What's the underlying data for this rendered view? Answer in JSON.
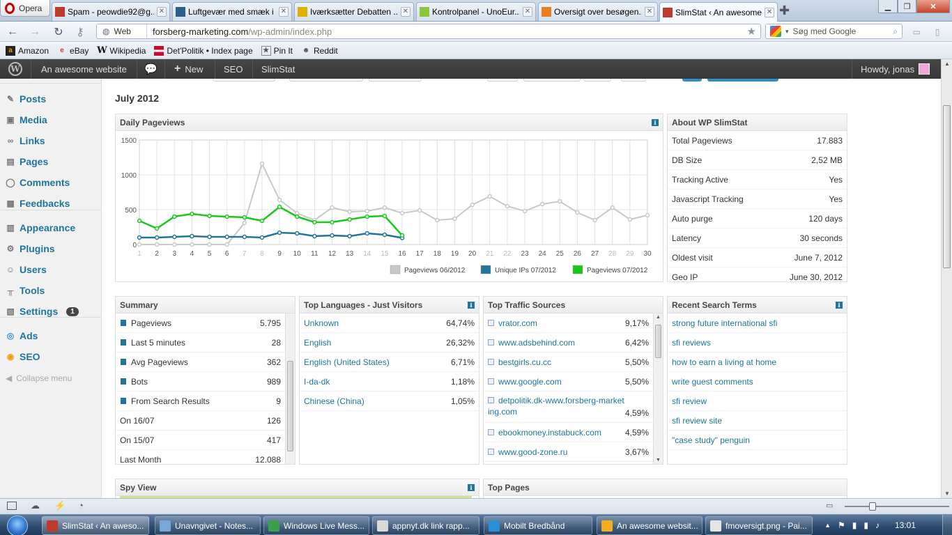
{
  "browser": {
    "menu_label": "Opera",
    "tabs": [
      {
        "title": "Spam - peowdie92@g...",
        "favicon": "gmail-icon",
        "color": "#c0392b"
      },
      {
        "title": "Luftgevær med smæk i",
        "favicon": "site-icon",
        "color": "#2c5f8a"
      },
      {
        "title": "Iværksætter Debatten ...",
        "favicon": "lightbulb-icon",
        "color": "#e0b000"
      },
      {
        "title": "Kontrolpanel - UnoEur...",
        "favicon": "one-icon",
        "color": "#8cc63f"
      },
      {
        "title": "Oversigt over besøgen...",
        "favicon": "chart-icon",
        "color": "#e67e22"
      },
      {
        "title": "SlimStat ‹ An awesome...",
        "favicon": "slimstat-icon",
        "color": "#c0392b"
      }
    ],
    "web_label": "Web",
    "url_host": "forsberg-marketing.com",
    "url_path": "/wp-admin/index.php",
    "search_placeholder": "Søg med Google",
    "bookmarks": [
      "Amazon",
      "eBay",
      "Wikipedia",
      "Det'Politik • Index page",
      "Pin It",
      "Reddit"
    ]
  },
  "adminbar": {
    "site_name": "An awesome website",
    "new_label": "New",
    "seo_label": "SEO",
    "slimstat_label": "SlimStat",
    "greeting": "Howdy, jonas"
  },
  "sidebar": {
    "items": [
      {
        "label": "Posts",
        "icon": "pin-icon"
      },
      {
        "label": "Media",
        "icon": "media-icon"
      },
      {
        "label": "Links",
        "icon": "link-icon"
      },
      {
        "label": "Pages",
        "icon": "pages-icon"
      },
      {
        "label": "Comments",
        "icon": "comment-icon"
      },
      {
        "label": "Feedbacks",
        "icon": "feedback-icon"
      },
      {
        "label": "Appearance",
        "icon": "appearance-icon"
      },
      {
        "label": "Plugins",
        "icon": "plugin-icon"
      },
      {
        "label": "Users",
        "icon": "users-icon"
      },
      {
        "label": "Tools",
        "icon": "tools-icon"
      },
      {
        "label": "Settings",
        "icon": "settings-icon",
        "badge": "1"
      },
      {
        "label": "Ads",
        "icon": "ads-icon"
      },
      {
        "label": "SEO",
        "icon": "seo-icon"
      }
    ],
    "collapse_label": "Collapse menu"
  },
  "page": {
    "month_title": "July 2012"
  },
  "daily_pageviews": {
    "title": "Daily Pageviews"
  },
  "chart_data": {
    "type": "line",
    "x": [
      1,
      2,
      3,
      4,
      5,
      6,
      7,
      8,
      9,
      10,
      11,
      12,
      13,
      14,
      15,
      16,
      17,
      18,
      19,
      20,
      21,
      22,
      23,
      24,
      25,
      26,
      27,
      28,
      29,
      30
    ],
    "ylim": [
      0,
      1500
    ],
    "yticks": [
      0,
      500,
      1000,
      1500
    ],
    "grid": true,
    "legend_position": "bottom-right",
    "weekend_days": [
      1,
      7,
      8,
      14,
      15,
      21,
      22,
      28,
      29
    ],
    "series": [
      {
        "name": "Pageviews 06/2012",
        "color": "#c8c8c8",
        "values": [
          0,
          0,
          0,
          0,
          0,
          0,
          310,
          1160,
          640,
          450,
          350,
          530,
          470,
          480,
          530,
          450,
          490,
          350,
          370,
          570,
          690,
          550,
          480,
          580,
          620,
          460,
          350,
          530,
          360,
          420
        ]
      },
      {
        "name": "Unique IPs 07/2012",
        "color": "#21759b",
        "values": [
          100,
          100,
          110,
          120,
          110,
          110,
          110,
          100,
          170,
          160,
          120,
          130,
          120,
          160,
          140,
          95
        ]
      },
      {
        "name": "Pageviews 07/2012",
        "color": "#18c818",
        "values": [
          340,
          230,
          400,
          440,
          410,
          400,
          390,
          340,
          540,
          400,
          320,
          320,
          360,
          400,
          410,
          130
        ]
      }
    ]
  },
  "about": {
    "title": "About WP SlimStat",
    "rows": [
      {
        "label": "Total Pageviews",
        "value": "17.883"
      },
      {
        "label": "DB Size",
        "value": "2,52 MB"
      },
      {
        "label": "Tracking Active",
        "value": "Yes"
      },
      {
        "label": "Javascript Tracking",
        "value": "Yes"
      },
      {
        "label": "Auto purge",
        "value": "120 days"
      },
      {
        "label": "Latency",
        "value": "30 seconds"
      },
      {
        "label": "Oldest visit",
        "value": "June 7, 2012"
      },
      {
        "label": "Geo IP",
        "value": "June 30, 2012"
      }
    ]
  },
  "summary": {
    "title": "Summary",
    "rows": [
      {
        "label": "Pageviews",
        "value": "5.795",
        "icon": true
      },
      {
        "label": "Last 5 minutes",
        "value": "28",
        "icon": true
      },
      {
        "label": "Avg Pageviews",
        "value": "362",
        "icon": true
      },
      {
        "label": "Bots",
        "value": "989",
        "icon": true
      },
      {
        "label": "From Search Results",
        "value": "9",
        "icon": true
      },
      {
        "label": "On 16/07",
        "value": "126",
        "icon": false
      },
      {
        "label": "On 15/07",
        "value": "417",
        "icon": false
      },
      {
        "label": "Last Month",
        "value": "12.088",
        "icon": false
      }
    ]
  },
  "languages": {
    "title": "Top Languages - Just Visitors",
    "rows": [
      {
        "label": "Unknown",
        "value": "64,74%"
      },
      {
        "label": "English",
        "value": "26,32%"
      },
      {
        "label": "English (United States)",
        "value": "6,71%"
      },
      {
        "label": "I-da-dk",
        "value": "1,18%"
      },
      {
        "label": "Chinese (China)",
        "value": "1,05%"
      }
    ]
  },
  "traffic": {
    "title": "Top Traffic Sources",
    "rows": [
      {
        "label": "vrator.com",
        "value": "9,17%"
      },
      {
        "label": "www.adsbehind.com",
        "value": "6,42%"
      },
      {
        "label": "bestgirls.cu.cc",
        "value": "5,50%"
      },
      {
        "label": "www.google.com",
        "value": "5,50%"
      },
      {
        "label": "detpolitik.dk-www.forsberg-marketing.com",
        "value": "4,59%",
        "tall": true
      },
      {
        "label": "ebookmoney.instabuck.com",
        "value": "4,59%"
      },
      {
        "label": "www.good-zone.ru",
        "value": "3,67%"
      }
    ]
  },
  "search_terms": {
    "title": "Recent Search Terms",
    "rows": [
      "strong future international sfi",
      "sfi reviews",
      "how to earn a living at home",
      "write guest comments",
      "sfi review",
      "sfi review site",
      "\"case study\" penguin"
    ]
  },
  "spy_view": {
    "title": "Spy View"
  },
  "top_pages": {
    "title": "Top Pages"
  },
  "taskbar": {
    "items": [
      {
        "label": "SlimStat ‹ An aweso...",
        "color": "#c0392b"
      },
      {
        "label": "Unavngivet - Notes...",
        "color": "#7aa7d8"
      },
      {
        "label": "Windows Live Mess...",
        "color": "#3aa14a"
      },
      {
        "label": "appnyt.dk link rapp...",
        "color": "#d9d9d9"
      },
      {
        "label": "Mobilt Bredbånd",
        "color": "#2a8fd6"
      },
      {
        "label": "An awesome websit...",
        "color": "#f2b01e"
      },
      {
        "label": "fmoversigt.png - Pai...",
        "color": "#e5e5e5"
      }
    ],
    "clock": "13:01"
  }
}
